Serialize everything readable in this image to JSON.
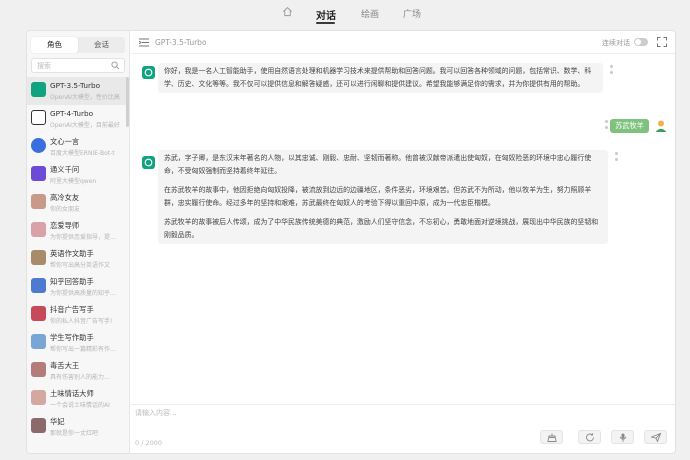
{
  "nav": {
    "tabs": [
      "对话",
      "绘画",
      "广场"
    ]
  },
  "sidebar": {
    "tabs": [
      "角色",
      "会话"
    ],
    "search_placeholder": "搜索",
    "items": [
      {
        "name": "GPT-3.5-Turbo",
        "desc": "OpenAI大模型，性价比高",
        "color": "#10a37f"
      },
      {
        "name": "GPT-4-Turbo",
        "desc": "OpenAI大模型，目前最好",
        "color": "#222222"
      },
      {
        "name": "文心一言",
        "desc": "百度大模型ERNIE-Bot-t",
        "color": "#3b6fe0"
      },
      {
        "name": "通义千问",
        "desc": "阿里大模型qwen",
        "color": "#6c4bd6"
      },
      {
        "name": "高冷女友",
        "desc": "你的女朋友",
        "color": "#c79a8a"
      },
      {
        "name": "恋爱导师",
        "desc": "为你提供恋爱指导，提...",
        "color": "#d9a2a8"
      },
      {
        "name": "英语作文助手",
        "desc": "帮你写出高分英语作文",
        "color": "#a88b6a"
      },
      {
        "name": "知乎回答助手",
        "desc": "为你提供高质量的知乎...",
        "color": "#4c7bd1"
      },
      {
        "name": "抖音广告写手",
        "desc": "你的私人抖音广告写手!",
        "color": "#c74a5a"
      },
      {
        "name": "学生写作助手",
        "desc": "帮你写出一篇精彩有作...",
        "color": "#7aa6d6"
      },
      {
        "name": "毒舌大王",
        "desc": "具有伤害别人的能力...",
        "color": "#b57c7c"
      },
      {
        "name": "土味情话大师",
        "desc": "一个会说土味情话的AI",
        "color": "#d4a7a0"
      },
      {
        "name": "华妃",
        "desc": "那就是你一丈红吧",
        "color": "#8a6a6a"
      }
    ]
  },
  "chat": {
    "model": "GPT-3.5-Turbo",
    "continuous_label": "连续对话",
    "welcome": "你好，我是一名人工智能助手，使用自然语言处理和机器学习技术来提供帮助和回答问题。我可以回答各种领域的问题，包括常识、数学、科学、历史、文化等等。我不仅可以提供信息和解答疑惑，还可以进行闲聊和提供建议。希望我能够满足你的需求，并为你提供有用的帮助。",
    "user_message": "苏武牧羊",
    "reply": [
      "苏武，字子卿，是东汉末年著名的人物，以其忠诚、刚毅、忠耐、坚韧而著称。他曾被汉献帝派遣出使匈奴，在匈奴险恶的环境中忠心履行使命，不受匈奴强制而坚持着终年延往。",
      "在苏武牧羊的故事中，他因拒绝向匈奴投降，被流放到边远的边疆地区，条件恶劣，环境艰苦。但苏武不为所动，他以牧羊为生，努力照顾羊群，忠实履行使命。经过多年的坚持和艰难，苏武最终在匈奴人的考验下得以重回中原，成为一代忠臣楷模。",
      "苏武牧羊的故事被后人传颂，成为了中华民族传统美德的典范，激励人们坚守信念，不忘初心，勇敢地面对逆境挑战，展现出中华民族的坚韧和刚毅品质。"
    ],
    "input_placeholder": "请输入内容...",
    "counter": "0 / 2000"
  }
}
